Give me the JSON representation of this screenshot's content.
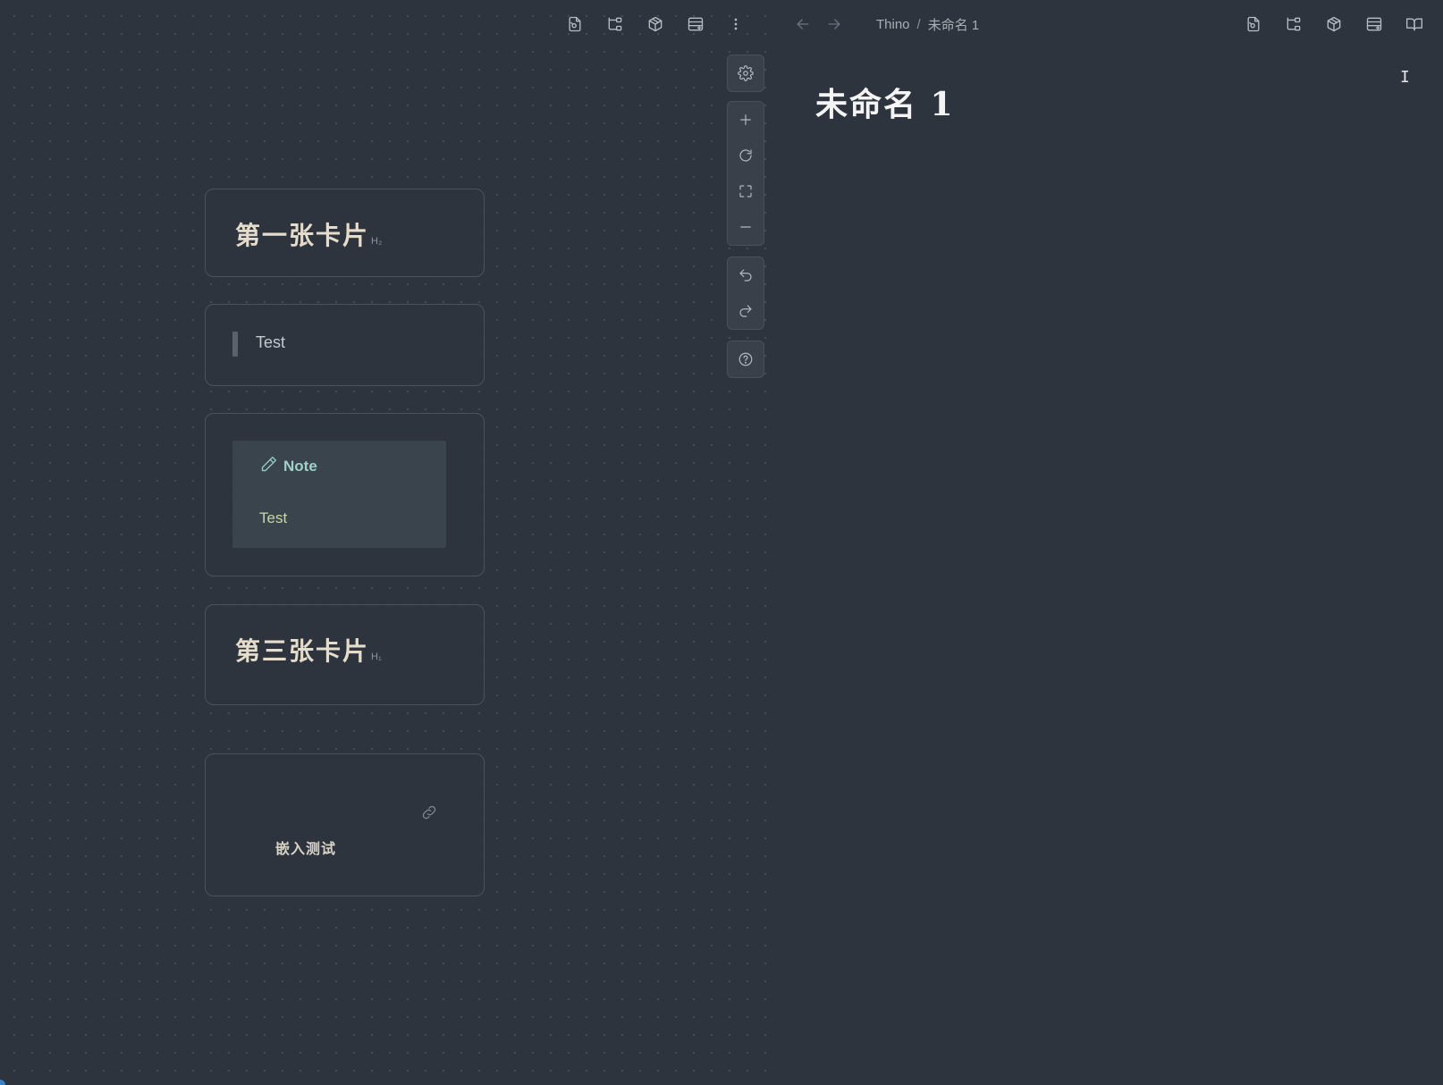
{
  "left_header": {
    "icons": [
      "file-open-icon",
      "tree-icon",
      "package-icon",
      "layout-icon",
      "more-vertical-icon"
    ]
  },
  "right_header": {
    "breadcrumb": {
      "folder": "Thino",
      "separator": "/",
      "file": "未命名 1"
    },
    "icons": [
      "file-open-icon",
      "tree-icon",
      "package-icon",
      "layout-icon",
      "book-open-icon"
    ]
  },
  "canvas_controls": {
    "groups": [
      [
        "settings-icon"
      ],
      [
        "zoom-in-icon",
        "reset-icon",
        "fit-icon",
        "zoom-out-icon"
      ],
      [
        "undo-icon",
        "redo-icon"
      ],
      [
        "help-icon"
      ]
    ]
  },
  "cards": {
    "card1": {
      "title": "第一张卡片",
      "level": "H₂"
    },
    "card2": {
      "quote": "Test"
    },
    "card3": {
      "callout_title": "Note",
      "callout_body": "Test"
    },
    "card4": {
      "title": "第三张卡片",
      "level": "H₁"
    },
    "card5": {
      "embed_text": "嵌入测试"
    }
  },
  "editor": {
    "title": "未命名 1"
  }
}
